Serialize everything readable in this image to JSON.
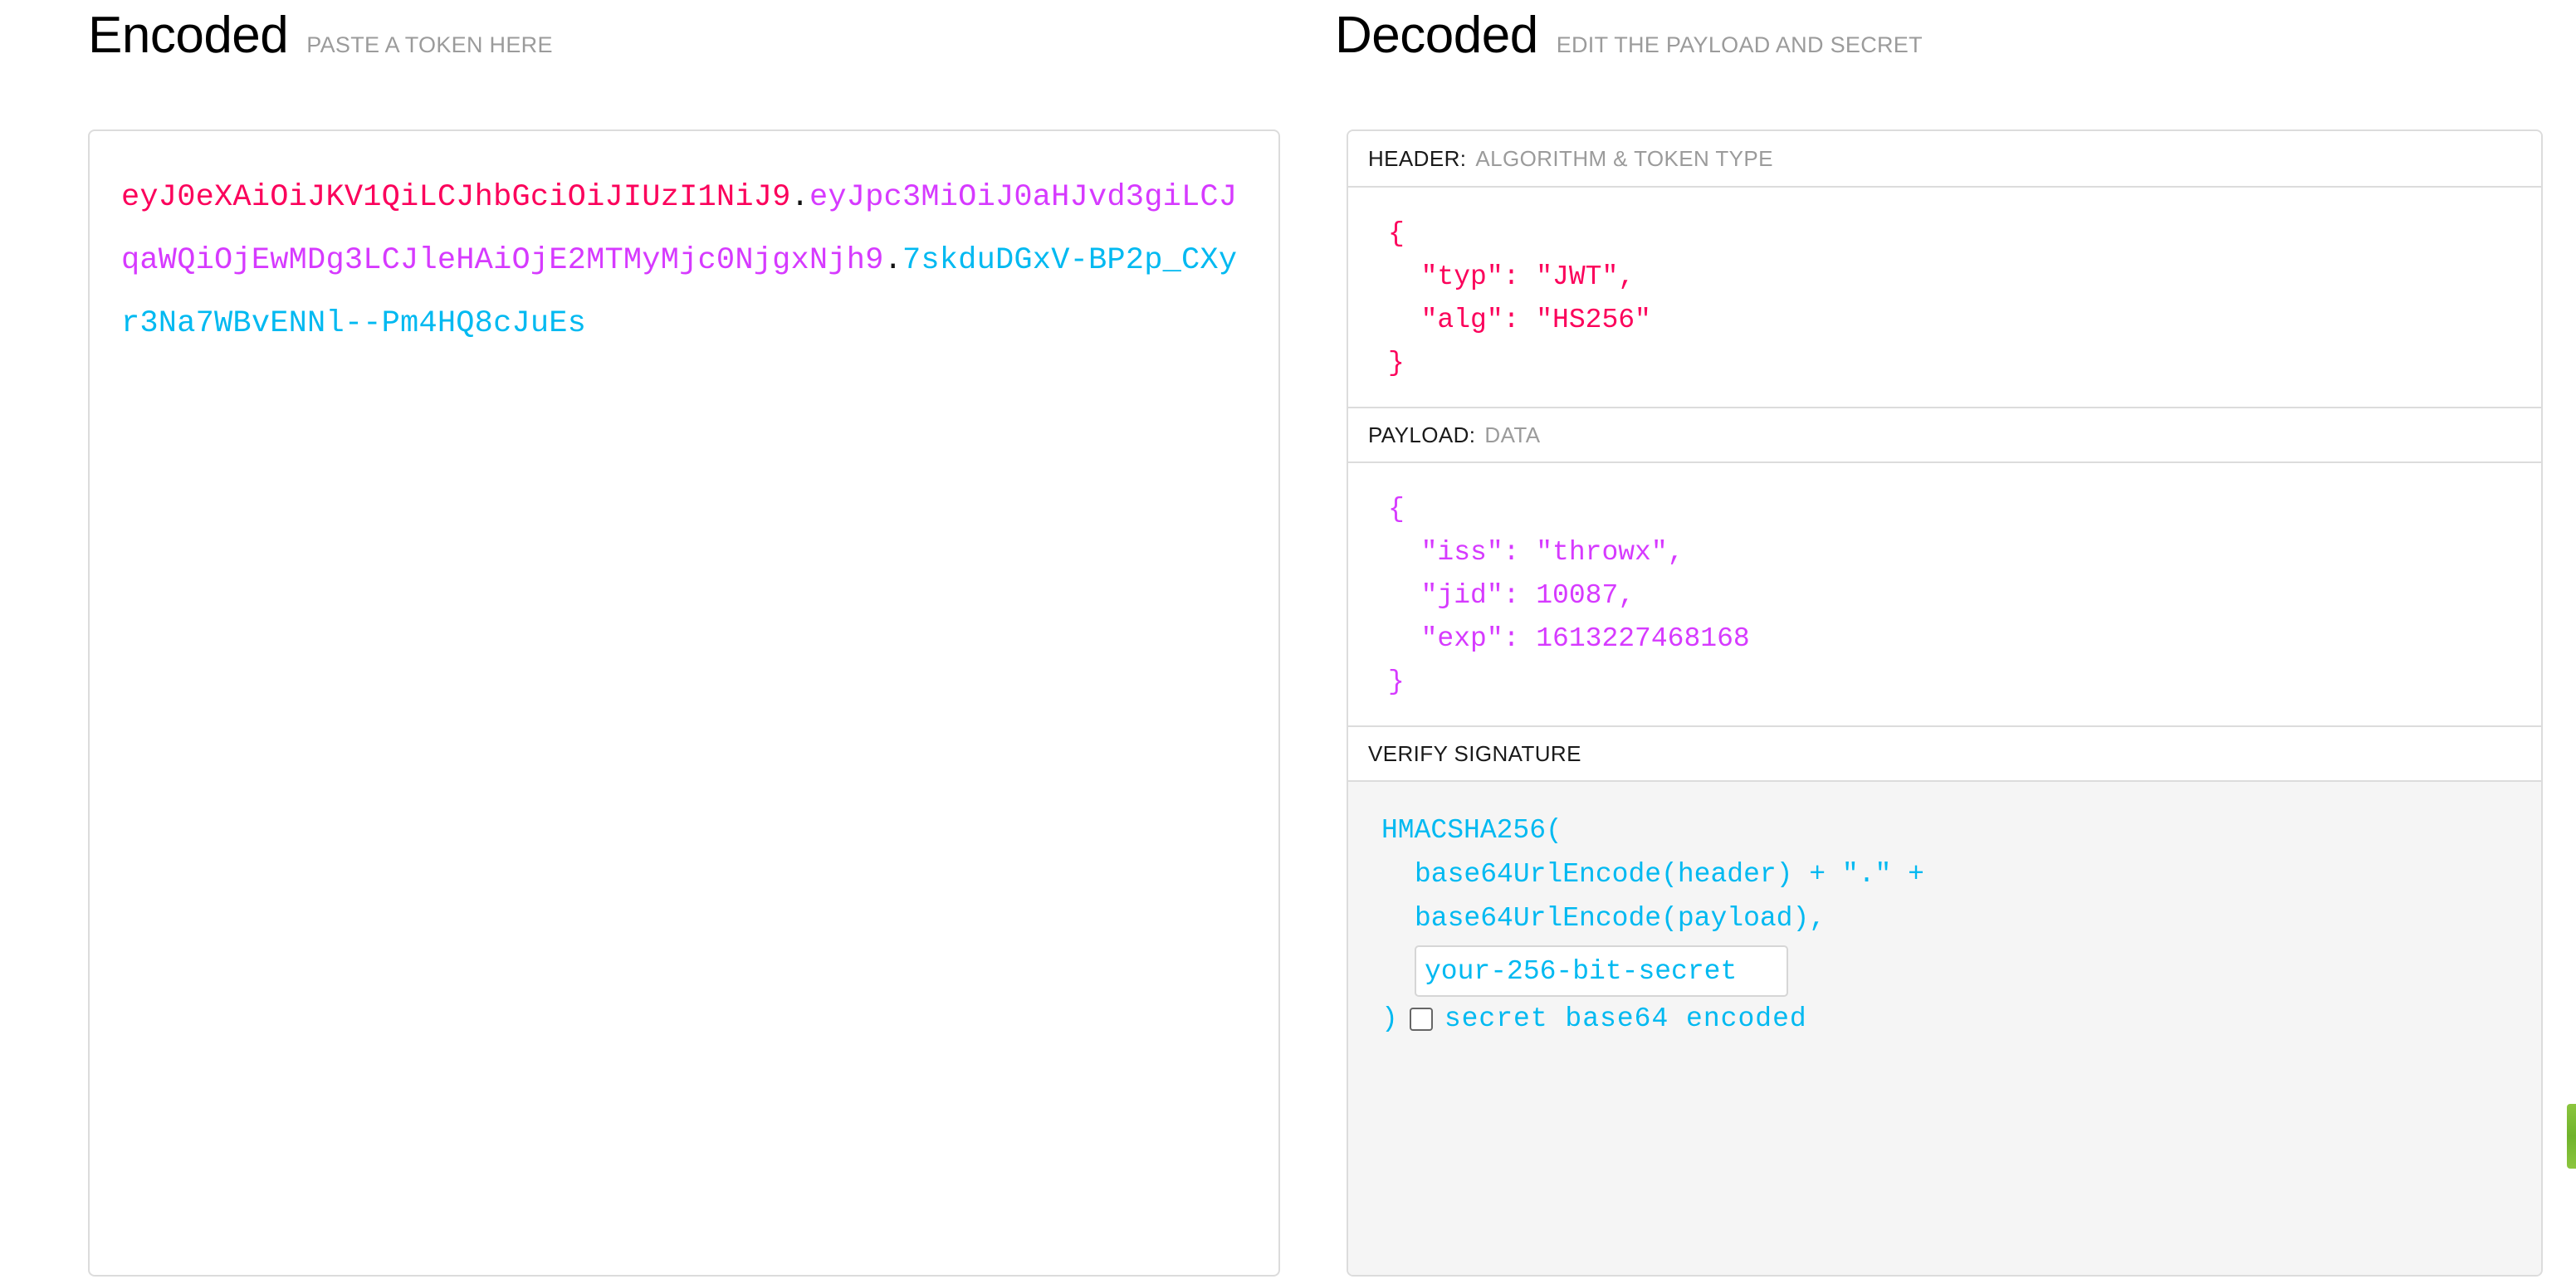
{
  "encoded": {
    "title": "Encoded",
    "subtitle": "PASTE A TOKEN HERE",
    "token": {
      "header": "eyJ0eXAiOiJKV1QiLCJhbGciOiJIUzI1NiJ9",
      "separator": ".",
      "payload": "eyJpc3MiOiJ0aHJvd3giLCJqaWQiOjEwMDg3LCJleHAiOjE2MTMyMjc0NjgxNjh9",
      "signature": "7skduDGxV-BP2p_CXyr3Na7WBvENNl--Pm4HQ8cJuEs"
    },
    "token_full": "eyJ0eXAiOiJKV1QiLCJhbGciOiJIUzI1NiJ9.eyJpc3MiOiJ0aHJvd3giLCJqaWQiOjEwMDg3LCJleHAiOjE2MTMyMjc0NjgxNjh9.7skduDGxV-BP2p_CXyr3Na7WBvENNl--Pm4HQ8cJuEs"
  },
  "decoded": {
    "title": "Decoded",
    "subtitle": "EDIT THE PAYLOAD AND SECRET",
    "header_section": {
      "label": "HEADER:",
      "hint": "ALGORITHM & TOKEN TYPE",
      "json": "{\n  \"typ\": \"JWT\",\n  \"alg\": \"HS256\"\n}"
    },
    "payload_section": {
      "label": "PAYLOAD:",
      "hint": "DATA",
      "json": "{\n  \"iss\": \"throwx\",\n  \"jid\": 10087,\n  \"exp\": 1613227468168\n}"
    },
    "signature_section": {
      "label": "VERIFY SIGNATURE",
      "line1": "HMACSHA256(",
      "line2": "base64UrlEncode(header) + \".\" +",
      "line3": "base64UrlEncode(payload),",
      "secret_value": "your-256-bit-secret",
      "secret_placeholder": "your-256-bit-secret",
      "closing_paren": ")",
      "base64_checkbox_label": "secret base64 encoded",
      "base64_checkbox_checked": false
    }
  },
  "colors": {
    "header_segment": "#fb015b",
    "payload_segment": "#d63aff",
    "signature_segment": "#00b9f1",
    "muted_text": "#9b9b9b",
    "panel_border": "#dcdcdc",
    "signature_background": "#f5f5f5",
    "verified_badge": "#8cc63f"
  }
}
